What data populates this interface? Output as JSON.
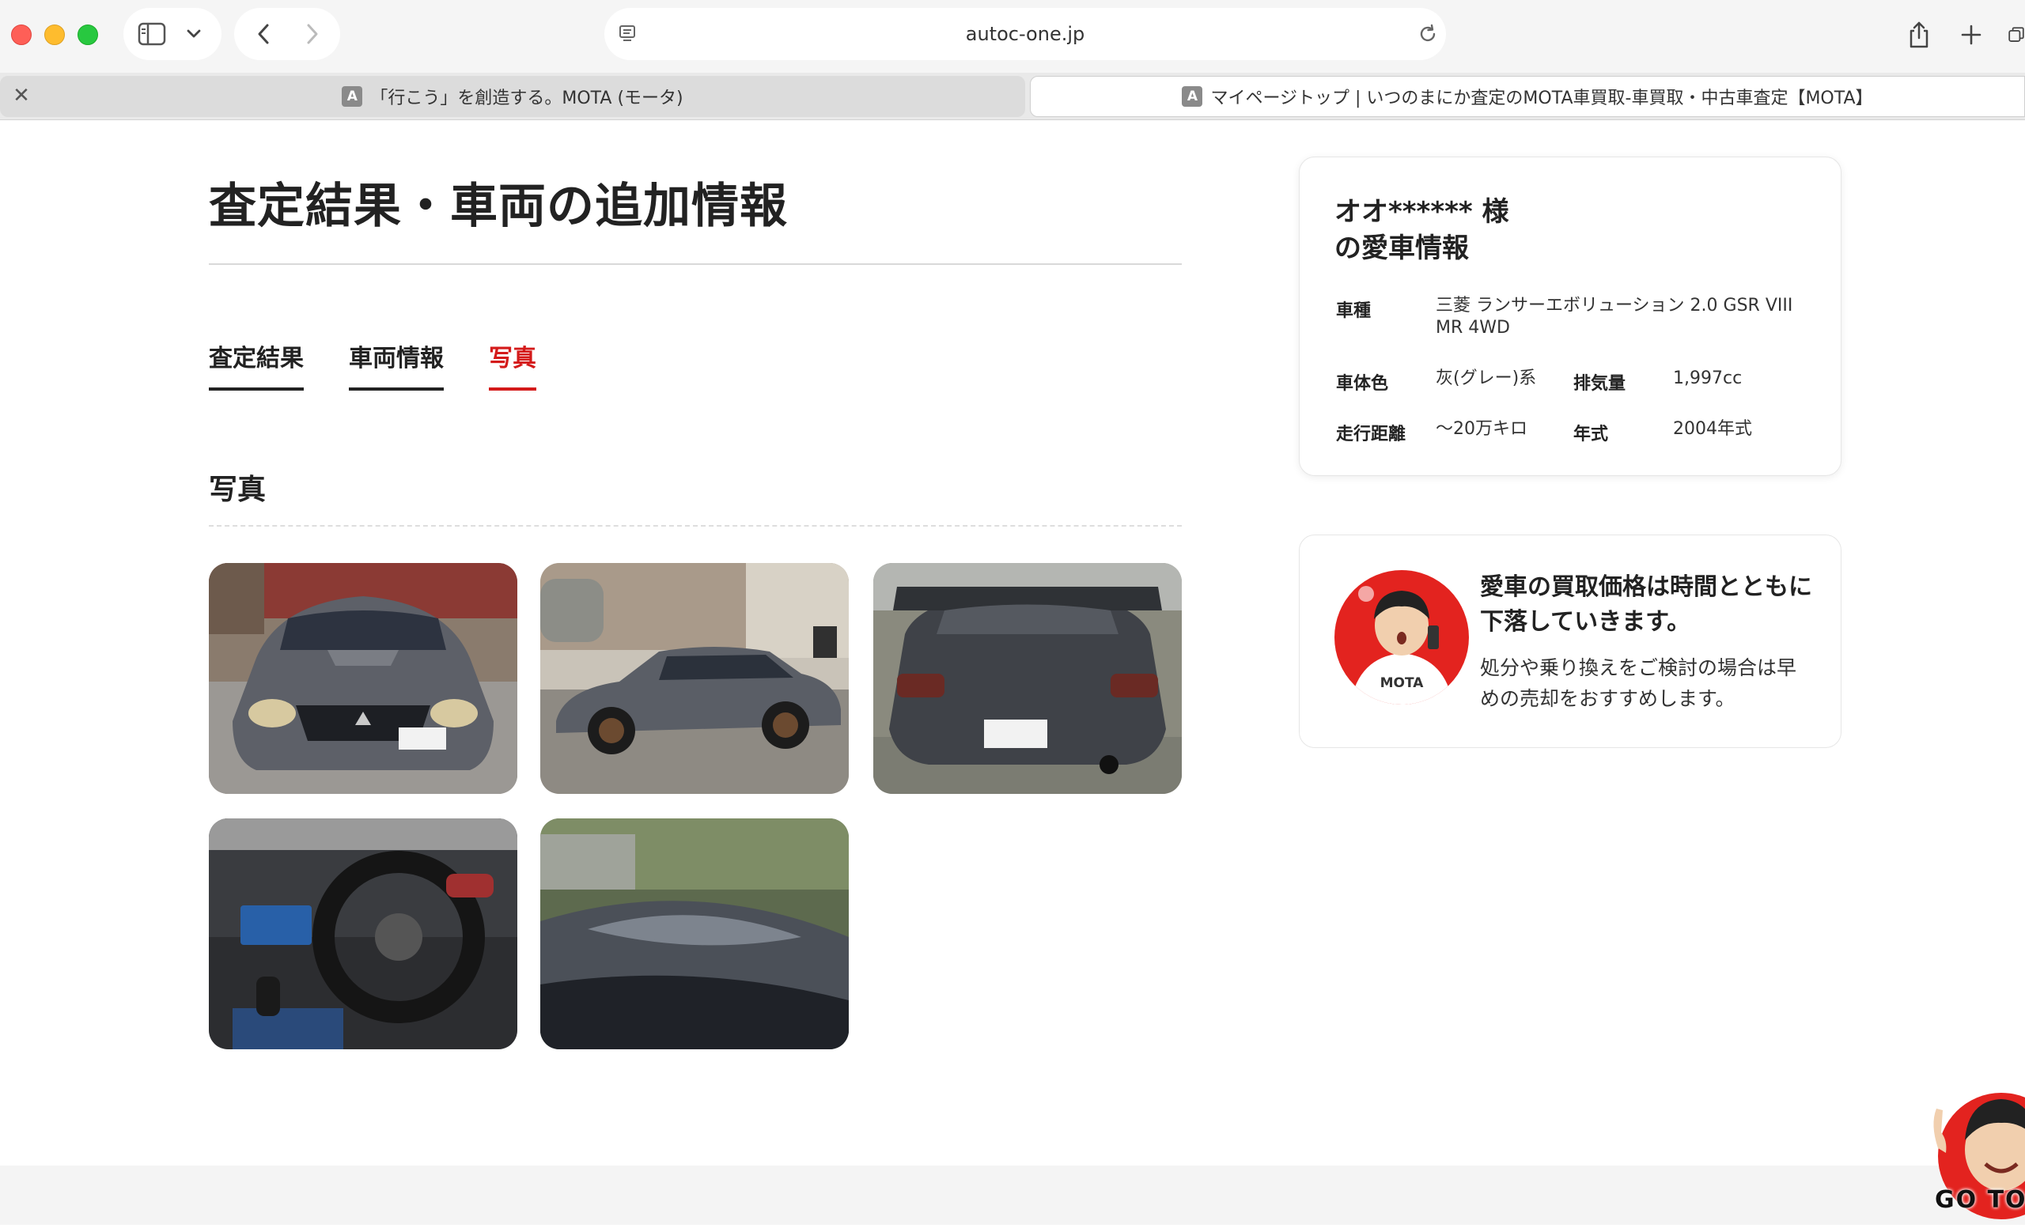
{
  "browser": {
    "url": "autoc-one.jp",
    "tabs": [
      {
        "favicon": "A",
        "title": "「行こう」を創造する。MOTA (モータ)"
      },
      {
        "favicon": "A",
        "title": "マイページトップ | いつのまにか査定のMOTA車買取-車買取・中古車査定【MOTA】"
      }
    ]
  },
  "page": {
    "title": "査定結果・車両の追加情報",
    "tabs": [
      "査定結果",
      "車両情報",
      "写真"
    ],
    "active_tab": "写真",
    "section_title": "写真",
    "photos": [
      {
        "icon": "car-front-photo"
      },
      {
        "icon": "car-side-photo"
      },
      {
        "icon": "car-rear-photo"
      },
      {
        "icon": "car-interior-photo"
      },
      {
        "icon": "car-roof-photo"
      }
    ]
  },
  "vehicle_card": {
    "owner_line1": "オオ****** 様",
    "owner_line2": "の愛車情報",
    "model_label": "車種",
    "model_value": "三菱 ランサーエボリューション 2.0 GSR VIII MR 4WD",
    "color_label": "車体色",
    "color_value": "灰(グレー)系",
    "displacement_label": "排気量",
    "displacement_value": "1,997cc",
    "mileage_label": "走行距離",
    "mileage_value": "〜20万キロ",
    "year_label": "年式",
    "year_value": "2004年式"
  },
  "promo": {
    "headline": "愛車の買取価格は時間とともに下落していきます。",
    "body": "処分や乗り換えをご検討の場合は早めの売却をおすすめします。",
    "avatar_text": "MOTA"
  },
  "gotop": {
    "label": "GO TOP"
  },
  "colors": {
    "accent": "#d41a1a",
    "text": "#222222"
  }
}
